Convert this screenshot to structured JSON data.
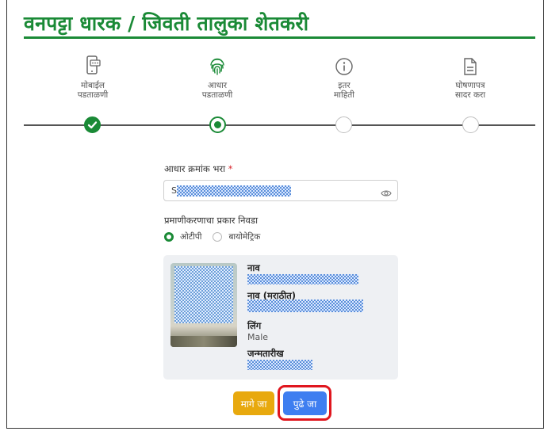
{
  "page": {
    "title": "वनपट्टा धारक / जिवती तालुका शेतकरी"
  },
  "stepper": {
    "steps": [
      {
        "line1": "मोबाईल",
        "line2": "पडताळणी",
        "icon": "mobile-verify-icon",
        "state": "done"
      },
      {
        "line1": "आधार",
        "line2": "पडताळणी",
        "icon": "fingerprint-icon",
        "state": "active"
      },
      {
        "line1": "इतर",
        "line2": "माहिती",
        "icon": "info-icon",
        "state": "pending"
      },
      {
        "line1": "घोषणापत्र",
        "line2": "सादर करा",
        "icon": "document-icon",
        "state": "pending"
      }
    ]
  },
  "form": {
    "aadhaar_label": "आधार क्रमांक भरा",
    "required_mark": "*",
    "aadhaar_prefix": "S",
    "auth_label": "प्रमाणीकरणाचा प्रकार निवडा",
    "options": [
      {
        "label": "ओटीपी",
        "selected": true
      },
      {
        "label": "बायोमेट्रिक",
        "selected": false
      }
    ]
  },
  "details": {
    "name_label": "नाव",
    "name_marathi_label": "नाव (मराठीत)",
    "gender_label": "लिंग",
    "gender_value": "Male",
    "dob_label": "जन्मतारीख"
  },
  "buttons": {
    "back": "मागे जा",
    "next": "पुढे जा"
  },
  "colors": {
    "primary_green": "#1a8a36",
    "next_blue": "#3e7ef0",
    "back_amber": "#e8a90e",
    "highlight_red": "#e0161e"
  }
}
